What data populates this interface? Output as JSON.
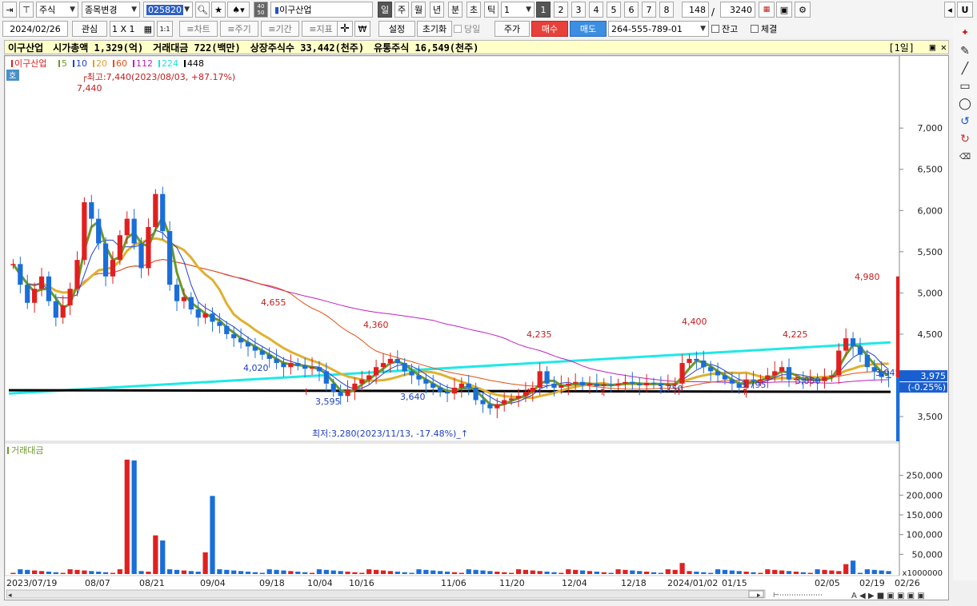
{
  "toolbar1": {
    "market_select": "주식",
    "change_select": "종목변경",
    "code": "025820",
    "name": "이구산업",
    "period_buttons": [
      "일",
      "주",
      "월",
      "년",
      "분",
      "초",
      "틱"
    ],
    "interval": "1",
    "page_buttons": [
      "1",
      "2",
      "3",
      "4",
      "5",
      "6",
      "7",
      "8"
    ],
    "count": "148",
    "total": "3240",
    "u_label": "U"
  },
  "toolbar2": {
    "date": "2024/02/26",
    "interest": "관심",
    "grid": "1 X 1",
    "one_one": "1:1",
    "chart_btns": [
      "≡차트",
      "≡주기",
      "≡기간",
      "≡지표"
    ],
    "settings": "설정",
    "reset": "초기화",
    "today": "당일",
    "price": "주가",
    "buy": "매수",
    "sell": "매도",
    "account": "264-555-789-01",
    "balance": "잔고",
    "fill": "체결"
  },
  "info": {
    "name": "이구산업",
    "mcap": "시가총액 1,329(억)",
    "amount": "거래대금 722(백만)",
    "listed": "상장주식수 33,442(천주)",
    "float": "유통주식 16,549(천주)",
    "period_tag": "[1일]"
  },
  "chart_data": [
    {
      "type": "candlestick",
      "title": "이구산업",
      "legend": [
        {
          "name": "이구산업",
          "color": "#e02020"
        },
        {
          "name": "5",
          "color": "#6b9a2a"
        },
        {
          "name": "10",
          "color": "#2040d0"
        },
        {
          "name": "20",
          "color": "#e0a030"
        },
        {
          "name": "60",
          "color": "#e05010"
        },
        {
          "name": "112",
          "color": "#c020c0"
        },
        {
          "name": "224",
          "color": "#20e0e0"
        },
        {
          "name": "448",
          "color": "#000000"
        }
      ],
      "y_ticks": [
        3500,
        4000,
        4500,
        5000,
        5500,
        6000,
        6500,
        7000
      ],
      "y_tick_labels": [
        "3,500",
        "4,000",
        "4,500",
        "5,000",
        "5,500",
        "6,000",
        "6,500",
        "7,000"
      ],
      "x_labels": [
        "2023/07/19",
        "08/07",
        "08/21",
        "09/04",
        "09/18",
        "10/04",
        "10/16",
        "11/06",
        "11/20",
        "12/04",
        "12/18",
        "2024/01/02",
        "01/15",
        "02/05",
        "02/19",
        "02/26"
      ],
      "high_note": "최고:7,440(2023/08/03, +87.17%)",
      "low_note": "최저:3,280(2023/11/13, -17.48%)",
      "peak_labels": [
        "7,440",
        "4,655",
        "4,360",
        "4,235",
        "4,400",
        "4,225",
        "4,980"
      ],
      "trough_labels": [
        "4,020",
        "3,595",
        "3,640",
        "3,750",
        "3,795",
        "3,850",
        "3,945"
      ],
      "current": {
        "price": "3,975",
        "change": "(-0.25%)"
      },
      "prices": [
        5350,
        5100,
        4880,
        5050,
        5200,
        4900,
        4700,
        4850,
        5050,
        5400,
        6100,
        5900,
        5600,
        5200,
        5400,
        5700,
        5900,
        5600,
        5300,
        5800,
        6200,
        5750,
        5100,
        4900,
        4950,
        4800,
        4700,
        4750,
        4650,
        4600,
        4500,
        4450,
        4400,
        4350,
        4300,
        4250,
        4200,
        4150,
        4100,
        4150,
        4120,
        4080,
        4100,
        4050,
        3900,
        3800,
        3750,
        3820,
        3900,
        3950,
        4000,
        4100,
        4150,
        4200,
        4150,
        4050,
        4000,
        3950,
        3900,
        3850,
        3800,
        3780,
        3850,
        3900,
        3850,
        3700,
        3650,
        3600,
        3650,
        3700,
        3720,
        3750,
        3800,
        3850,
        4050,
        3900,
        3850,
        3880,
        3900,
        3920,
        3880,
        3900,
        3870,
        3890,
        3880,
        3900,
        3920,
        3900,
        3880,
        3910,
        3900,
        3880,
        3890,
        3900,
        4150,
        4200,
        4180,
        4100,
        4050,
        4000,
        3950,
        3900,
        3850,
        3950,
        3930,
        3950,
        4000,
        4050,
        4100,
        3950,
        3960,
        3940,
        3950,
        3930,
        3980,
        4000,
        4300,
        4450,
        4350,
        4250,
        4100,
        4050,
        3980,
        3975
      ]
    },
    {
      "type": "bar",
      "title": "거래대금",
      "y_ticks": [
        50000,
        100000,
        150000,
        200000,
        250000
      ],
      "y_tick_labels": [
        "50,000",
        "100,000",
        "150,000",
        "200,000",
        "250,000"
      ],
      "unit": "x1000000",
      "spikes": [
        {
          "index": 16,
          "value": 290000
        },
        {
          "index": 17,
          "value": 288000
        },
        {
          "index": 20,
          "value": 98000
        },
        {
          "index": 21,
          "value": 85000
        },
        {
          "index": 27,
          "value": 55000
        },
        {
          "index": 28,
          "value": 198000
        }
      ]
    }
  ]
}
